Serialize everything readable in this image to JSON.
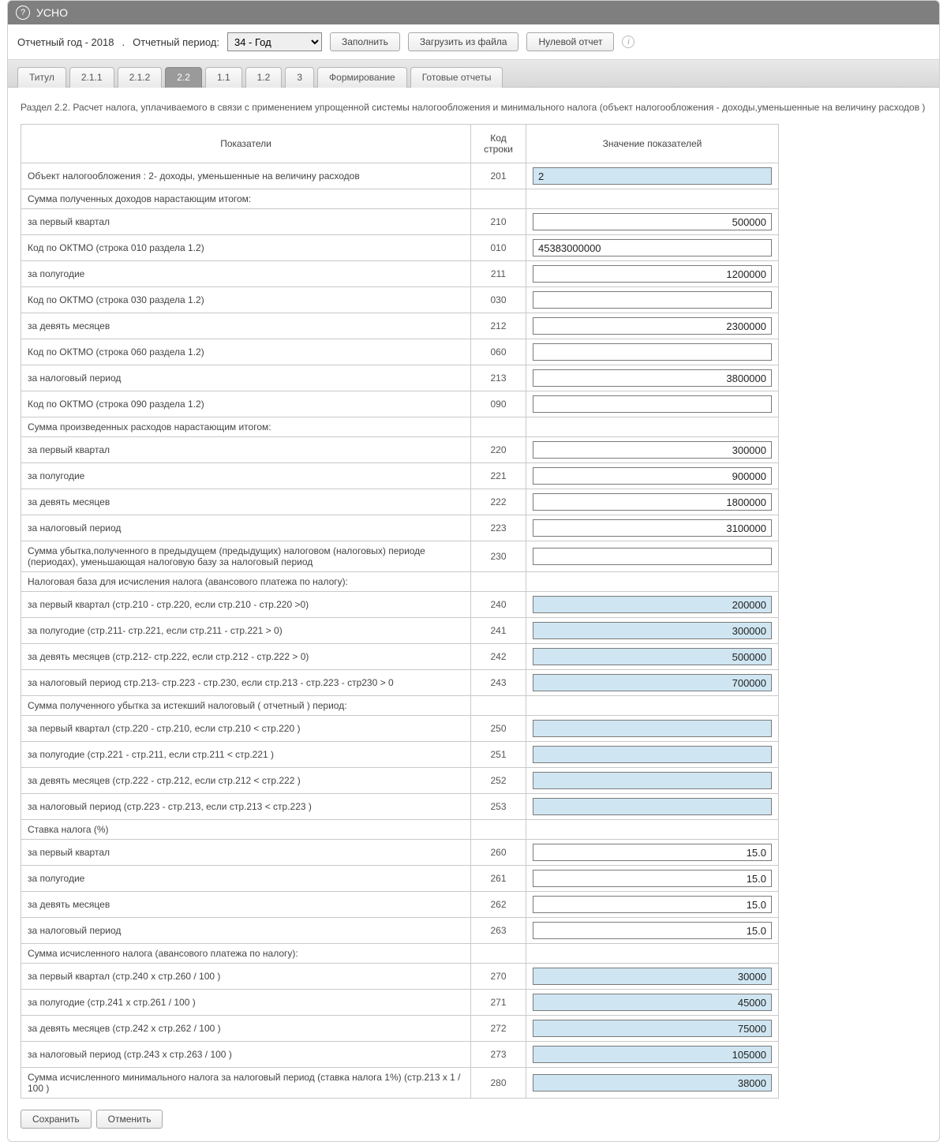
{
  "window": {
    "title": "УСНО"
  },
  "toolbar": {
    "year_label": "Отчетный год -  2018",
    "period_label": "Отчетный период:",
    "period_value": "34 - Год",
    "fill": "Заполнить",
    "load_file": "Загрузить из файла",
    "zero_report": "Нулевой отчет"
  },
  "tabs": [
    {
      "label": "Титул",
      "active": false
    },
    {
      "label": "2.1.1",
      "active": false
    },
    {
      "label": "2.1.2",
      "active": false
    },
    {
      "label": "2.2",
      "active": true
    },
    {
      "label": "1.1",
      "active": false
    },
    {
      "label": "1.2",
      "active": false
    },
    {
      "label": "3",
      "active": false
    },
    {
      "label": "Формирование",
      "active": false
    },
    {
      "label": "Готовые отчеты",
      "active": false
    }
  ],
  "section_title": "Раздел 2.2. Расчет налога, уплачиваемого в связи с применением упрощенной системы налогообложения и минимального налога (объект налогообложения - доходы,уменьшенные на величину расходов )",
  "columns": {
    "c1": "Показатели",
    "c2": "Код строки",
    "c3": "Значение показателей"
  },
  "rows": [
    {
      "label": "Объект налогообложения : 2- доходы, уменьшенные на величину расходов",
      "code": "201",
      "field": "readonly",
      "align": "left",
      "value": "2"
    },
    {
      "label": "Сумма полученных доходов нарастающим итогом:",
      "code": "",
      "field": "none"
    },
    {
      "label": "за первый квартал",
      "code": "210",
      "field": "input",
      "align": "right",
      "value": "500000"
    },
    {
      "label": "Код по ОКТМО (строка 010 раздела 1.2)",
      "code": "010",
      "field": "input",
      "align": "left",
      "value": "45383000000"
    },
    {
      "label": "за полугодие",
      "code": "211",
      "field": "input",
      "align": "right",
      "value": "1200000"
    },
    {
      "label": "Код по ОКТМО (строка 030 раздела 1.2)",
      "code": "030",
      "field": "input",
      "align": "left",
      "value": ""
    },
    {
      "label": "за девять месяцев",
      "code": "212",
      "field": "input",
      "align": "right",
      "value": "2300000"
    },
    {
      "label": "Код по ОКТМО (строка 060 раздела 1.2)",
      "code": "060",
      "field": "input",
      "align": "left",
      "value": ""
    },
    {
      "label": "за налоговый период",
      "code": "213",
      "field": "input",
      "align": "right",
      "value": "3800000"
    },
    {
      "label": "Код по ОКТМО (строка 090 раздела 1.2)",
      "code": "090",
      "field": "input",
      "align": "left",
      "value": ""
    },
    {
      "label": "Сумма произведенных расходов нарастающим итогом:",
      "code": "",
      "field": "none"
    },
    {
      "label": "за первый квартал",
      "code": "220",
      "field": "input",
      "align": "right",
      "value": "300000"
    },
    {
      "label": "за полугодие",
      "code": "221",
      "field": "input",
      "align": "right",
      "value": "900000"
    },
    {
      "label": "за девять месяцев",
      "code": "222",
      "field": "input",
      "align": "right",
      "value": "1800000"
    },
    {
      "label": "за налоговый период",
      "code": "223",
      "field": "input",
      "align": "right",
      "value": "3100000"
    },
    {
      "label": "Сумма убытка,полученного в предыдущем (предыдущих) налоговом (налоговых) периоде (периодах), уменьшающая налоговую базу за налоговый период",
      "code": "230",
      "field": "input",
      "align": "right",
      "value": ""
    },
    {
      "label": "Налоговая база для исчисления налога (авансового платежа по налогу):",
      "code": "",
      "field": "none"
    },
    {
      "label": "за первый квартал (стр.210 - стр.220, если стр.210 - стр.220 >0)",
      "code": "240",
      "field": "readonly",
      "align": "right",
      "value": "200000"
    },
    {
      "label": "за полугодие (стр.211- стр.221, если стр.211 - стр.221 > 0)",
      "code": "241",
      "field": "readonly",
      "align": "right",
      "value": "300000"
    },
    {
      "label": "за девять месяцев (стр.212- стр.222, если стр.212 - стр.222 > 0)",
      "code": "242",
      "field": "readonly",
      "align": "right",
      "value": "500000"
    },
    {
      "label": "за налоговый период стр.213- стр.223 - стр.230, если стр.213 - стр.223 - стр230 > 0",
      "code": "243",
      "field": "readonly",
      "align": "right",
      "value": "700000"
    },
    {
      "label": "Сумма полученного убытка за истекший налоговый ( отчетный ) период:",
      "code": "",
      "field": "none"
    },
    {
      "label": "за первый квартал (стр.220 - стр.210, если стр.210 < стр.220 )",
      "code": "250",
      "field": "readonly",
      "align": "right",
      "value": ""
    },
    {
      "label": "за полугодие (стр.221 - стр.211, если стр.211 < стр.221 )",
      "code": "251",
      "field": "readonly",
      "align": "right",
      "value": ""
    },
    {
      "label": "за девять месяцев (стр.222 - стр.212, если стр.212 < стр.222 )",
      "code": "252",
      "field": "readonly",
      "align": "right",
      "value": ""
    },
    {
      "label": "за налоговый период (стр.223 - стр.213, если стр.213 < стр.223 )",
      "code": "253",
      "field": "readonly",
      "align": "right",
      "value": ""
    },
    {
      "label": "Ставка налога (%)",
      "code": "",
      "field": "none"
    },
    {
      "label": "за первый квартал",
      "code": "260",
      "field": "input",
      "align": "right",
      "value": "15.0"
    },
    {
      "label": "за полугодие",
      "code": "261",
      "field": "input",
      "align": "right",
      "value": "15.0"
    },
    {
      "label": "за девять месяцев",
      "code": "262",
      "field": "input",
      "align": "right",
      "value": "15.0"
    },
    {
      "label": "за налоговый период",
      "code": "263",
      "field": "input",
      "align": "right",
      "value": "15.0"
    },
    {
      "label": "Сумма исчисленного налога (авансового платежа по налогу):",
      "code": "",
      "field": "none"
    },
    {
      "label": "за первый квартал (стр.240 х стр.260 / 100 )",
      "code": "270",
      "field": "readonly",
      "align": "right",
      "value": "30000"
    },
    {
      "label": "за полугодие (стр.241 х стр.261 / 100 )",
      "code": "271",
      "field": "readonly",
      "align": "right",
      "value": "45000"
    },
    {
      "label": "за девять месяцев (стр.242 х стр.262 / 100 )",
      "code": "272",
      "field": "readonly",
      "align": "right",
      "value": "75000"
    },
    {
      "label": "за налоговый период (стр.243 х стр.263 / 100 )",
      "code": "273",
      "field": "readonly",
      "align": "right",
      "value": "105000"
    },
    {
      "label": "Сумма исчисленного минимального налога за налоговый период (ставка налога 1%) (стр.213 x 1 / 100 )",
      "code": "280",
      "field": "readonly",
      "align": "right",
      "value": "38000"
    }
  ],
  "footer": {
    "save": "Сохранить",
    "cancel": "Отменить"
  }
}
